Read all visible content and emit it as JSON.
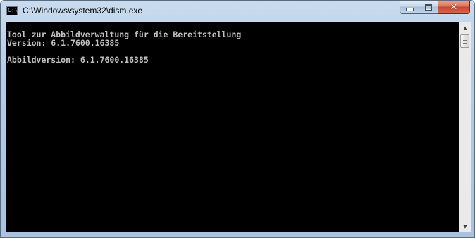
{
  "window": {
    "title": "C:\\Windows\\system32\\dism.exe",
    "icon": "console-icon"
  },
  "caption_buttons": {
    "minimize": "minimize-icon",
    "maximize": "maximize-icon",
    "close": "close-icon",
    "close_glyph": "✕"
  },
  "console": {
    "background": "#000000",
    "text_color": "#c0c0c0",
    "lines": [
      "Tool zur Abbildverwaltung für die Bereitstellung",
      "Version: 6.1.7600.16385",
      "",
      "Abbildversion: 6.1.7600.16385"
    ]
  },
  "scrollbar": {
    "up_arrow": "▲",
    "down_arrow": "▼"
  }
}
